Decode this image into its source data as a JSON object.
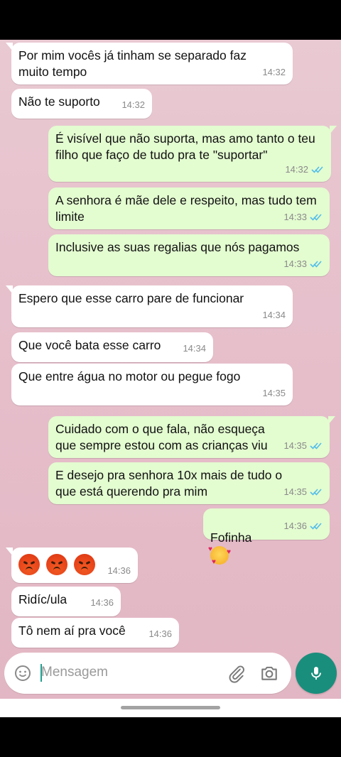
{
  "messages": [
    {
      "dir": "in",
      "text": "Por mim vocês já tinham se separado faz muito tempo",
      "time": "14:32"
    },
    {
      "dir": "in",
      "text": "Não te suporto",
      "time": "14:32"
    },
    {
      "dir": "out",
      "text": "É visível que não suporta, mas amo tanto o teu filho que faço de tudo pra te \"suportar\"",
      "time": "14:32"
    },
    {
      "dir": "out",
      "text": "A senhora é mãe dele e respeito, mas tudo tem limite",
      "time": "14:33"
    },
    {
      "dir": "out",
      "text": "Inclusive as suas regalias que nós pagamos",
      "time": "14:33"
    },
    {
      "dir": "in",
      "text": "Espero que esse carro pare de funcionar",
      "time": "14:34"
    },
    {
      "dir": "in",
      "text": "Que você bata esse carro",
      "time": "14:34"
    },
    {
      "dir": "in",
      "text": "Que entre água no motor ou pegue fogo",
      "time": "14:35"
    },
    {
      "dir": "out",
      "text": "Cuidado com o que fala, não esqueça que sempre estou com as crianças viu",
      "time": "14:35"
    },
    {
      "dir": "out",
      "text": "E desejo pra senhora 10x mais de tudo o que está querendo pra mim",
      "time": "14:35"
    },
    {
      "dir": "out",
      "text": "Fofinha",
      "emoji": "smiling-face-with-hearts",
      "time": "14:36"
    },
    {
      "dir": "in",
      "text": "",
      "emoji": "pouting-face x3",
      "time": "14:36"
    },
    {
      "dir": "in",
      "text": "Ridíc/ula",
      "time": "14:36"
    },
    {
      "dir": "in",
      "text": "Tô nem aí pra você",
      "time": "14:36"
    }
  ],
  "composer": {
    "placeholder": "Mensagem",
    "icons": [
      "emoji-icon",
      "attach-icon",
      "camera-icon",
      "mic-icon"
    ]
  },
  "colors": {
    "incoming_bubble": "#ffffff",
    "outgoing_bubble": "#e3fcd0",
    "read_ticks": "#53bdeb",
    "mic_button": "#1a8e7c"
  }
}
